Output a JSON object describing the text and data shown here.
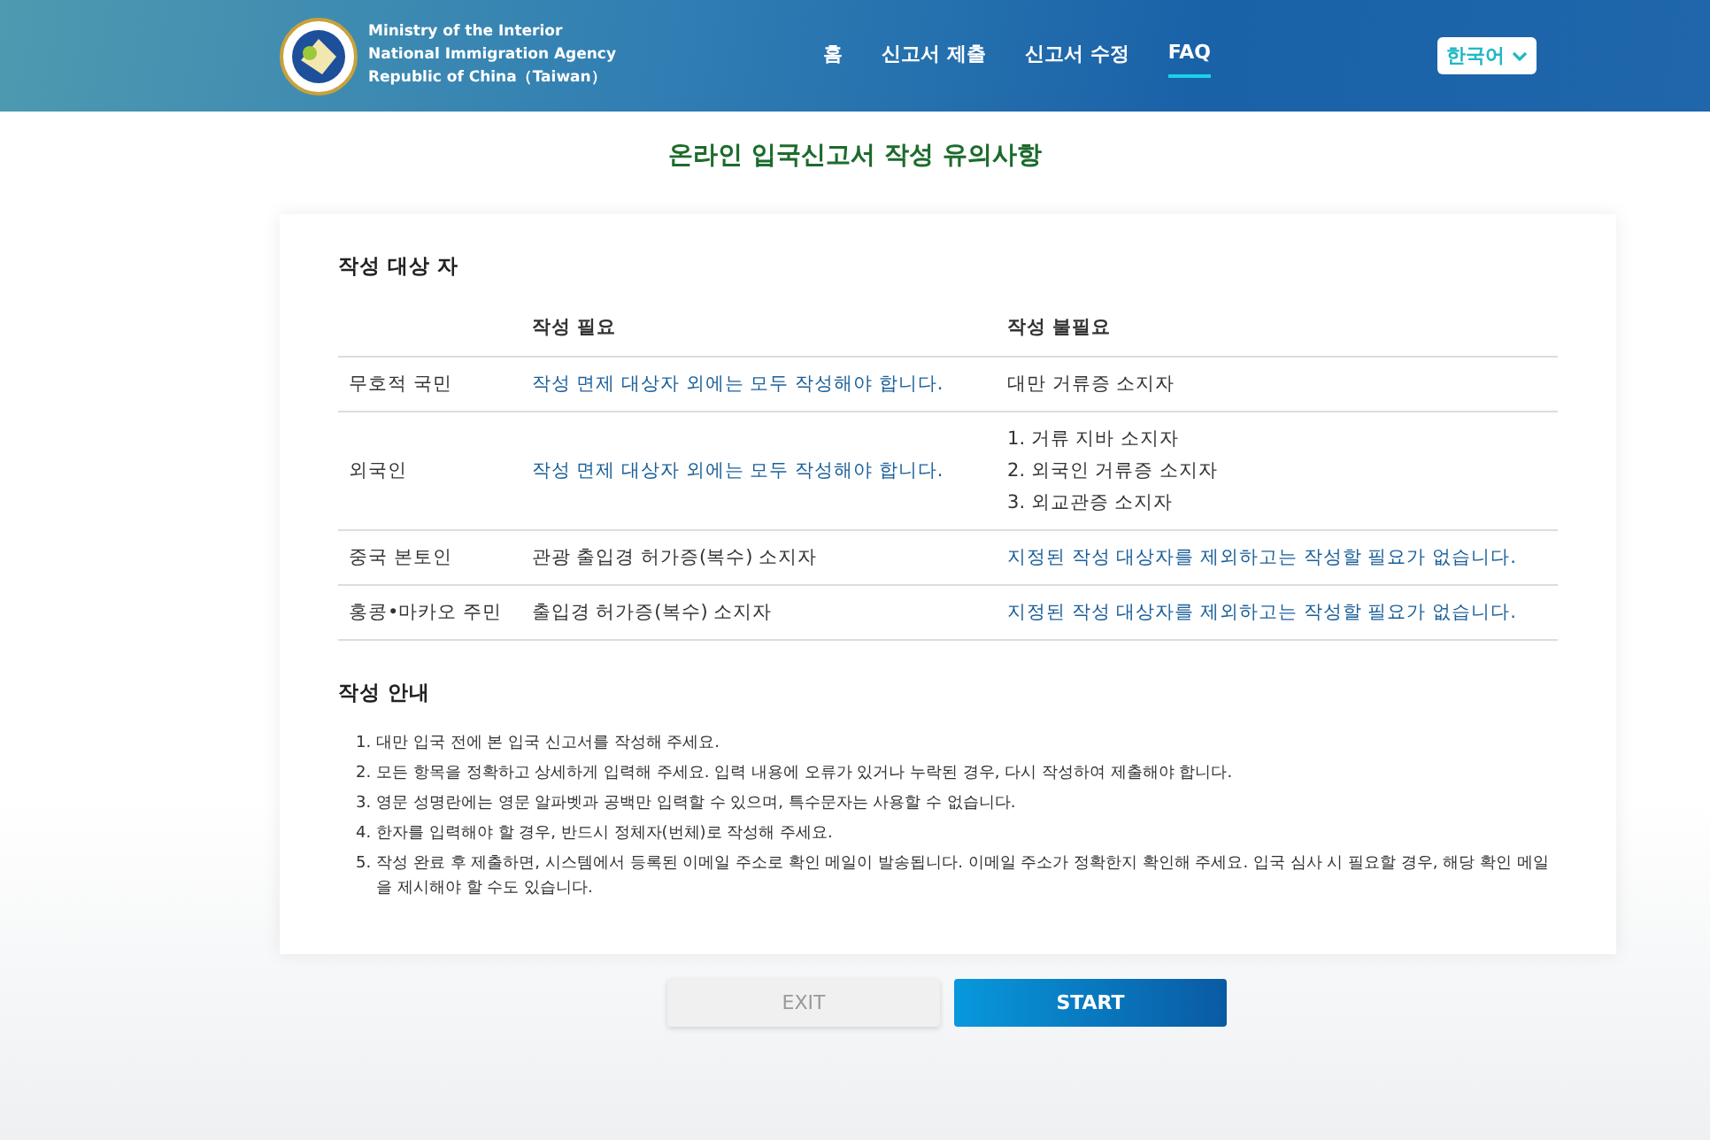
{
  "header": {
    "agency_lines": [
      "Ministry of the Interior",
      "National Immigration Agency",
      "Republic of China（Taiwan）"
    ],
    "nav": [
      {
        "label": "홈",
        "selected": false
      },
      {
        "label": "신고서 제출",
        "selected": false
      },
      {
        "label": "신고서 수정",
        "selected": false
      },
      {
        "label": "FAQ",
        "selected": true
      }
    ],
    "language": "한국어"
  },
  "title": "온라인 입국신고서 작성 유의사항",
  "targets": {
    "heading": "작성 대상 자",
    "columns": [
      "작성 필요",
      "작성 불필요"
    ],
    "rows": [
      {
        "label": "무호적 국민",
        "required": {
          "lines": [
            "작성 면제 대상자 외에는 모두 작성해야 합니다."
          ],
          "emphasis": true
        },
        "not_required": {
          "lines": [
            "대만 거류증 소지자"
          ],
          "emphasis": false
        }
      },
      {
        "label": "외국인",
        "required": {
          "lines": [
            "작성 면제 대상자 외에는 모두 작성해야 합니다."
          ],
          "emphasis": true
        },
        "not_required": {
          "lines": [
            "1. 거류 지바 소지자",
            "2. 외국인 거류증 소지자",
            "3. 외교관증 소지자"
          ],
          "emphasis": false
        }
      },
      {
        "label": "중국 본토인",
        "required": {
          "lines": [
            "관광 출입경 허가증(복수) 소지자"
          ],
          "emphasis": false
        },
        "not_required": {
          "lines": [
            "지정된 작성 대상자를 제외하고는 작성할 필요가 없습니다."
          ],
          "emphasis": true
        }
      },
      {
        "label": "홍콩•마카오 주민",
        "required": {
          "lines": [
            "출입경 허가증(복수) 소지자"
          ],
          "emphasis": false
        },
        "not_required": {
          "lines": [
            "지정된 작성 대상자를 제외하고는 작성할 필요가 없습니다."
          ],
          "emphasis": true
        }
      }
    ]
  },
  "guide": {
    "heading": "작성 안내",
    "items": [
      {
        "number": "1.",
        "text": "대만 입국 전에 본 입국 신고서를 작성해 주세요."
      },
      {
        "number": "2.",
        "text": "모든 항목을 정확하고 상세하게 입력해 주세요. 입력 내용에 오류가 있거나 누락된 경우, 다시 작성하여 제출해야 합니다."
      },
      {
        "number": "3.",
        "text": "영문 성명란에는 영문 알파벳과 공백만 입력할 수 있으며, 특수문자는 사용할 수 없습니다."
      },
      {
        "number": "4.",
        "text": "한자를 입력해야 할 경우, 반드시 정체자(번체)로 작성해 주세요."
      },
      {
        "number": "5.",
        "text": "작성 완료 후 제출하면, 시스템에서 등록된 이메일 주소로 확인 메일이 발송됩니다. 이메일 주소가 정확한지 확인해 주세요. 입국 심사 시 필요할 경우, 해당 확인 메일을 제시해야 할 수도 있습니다."
      }
    ]
  },
  "buttons": {
    "exit": "EXIT",
    "start": "START"
  }
}
